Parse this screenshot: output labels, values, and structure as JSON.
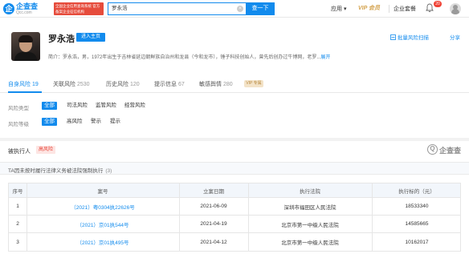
{
  "header": {
    "logo_mark": "企",
    "logo_title": "企查查",
    "logo_sub": "Qcc.com",
    "banner_text": "全国企业信用查询系统 官方备案企业征信机构",
    "search_value": "罗永浩",
    "search_button": "查一下",
    "nav_app": "应用",
    "nav_vip": "VIP 会员",
    "nav_enterprise": "企业套餐",
    "notification_count": "20"
  },
  "profile": {
    "name": "罗永浩",
    "enter_button": "进入主页",
    "bio_text": "简介：罗永浩，男，1972年出生于吉林省延边朝鲜族自治州和龙县（今和龙市），锤子科技创始人，曾先后创办过牛博网，老罗...",
    "bio_more": "展开",
    "scan_button": "批量风险扫描",
    "share_button": "分享"
  },
  "tabs": [
    {
      "label": "自身风险",
      "count": "19"
    },
    {
      "label": "关联风险",
      "count": "2530"
    },
    {
      "label": "历史风险",
      "count": "120"
    },
    {
      "label": "提示信息",
      "count": "67"
    },
    {
      "label": "敏感舆情",
      "count": "280"
    }
  ],
  "vip_tag": "VIP 专属",
  "filters": {
    "type": {
      "label": "风险类型",
      "options": [
        "全部",
        "司法风险",
        "监管风险",
        "经营风险"
      ]
    },
    "level": {
      "label": "风险等级",
      "options": [
        "全部",
        "高风险",
        "警示",
        "提示"
      ]
    }
  },
  "section": {
    "title": "被执行人",
    "tag": "高风险",
    "watermark": "企查查",
    "sub_title": "TA因未按时履行法律义务被法院强制执行",
    "sub_count": "(3)"
  },
  "table": {
    "headers": [
      "序号",
      "案号",
      "立案日期",
      "执行法院",
      "执行标的（元）"
    ],
    "rows": [
      {
        "idx": "1",
        "case": "（2021）粤0304执22626号",
        "date": "2021-06-09",
        "court": "深圳市福田区人民法院",
        "amount": "18533340"
      },
      {
        "idx": "2",
        "case": "（2021）京01执544号",
        "date": "2021-04-19",
        "court": "北京市第一中级人民法院",
        "amount": "14585665"
      },
      {
        "idx": "3",
        "case": "（2021）京01执495号",
        "date": "2021-04-12",
        "court": "北京市第一中级人民法院",
        "amount": "10162017"
      }
    ]
  },
  "colors": {
    "accent": "#128bed",
    "danger": "#e8473b",
    "vip": "#d4a24c"
  }
}
